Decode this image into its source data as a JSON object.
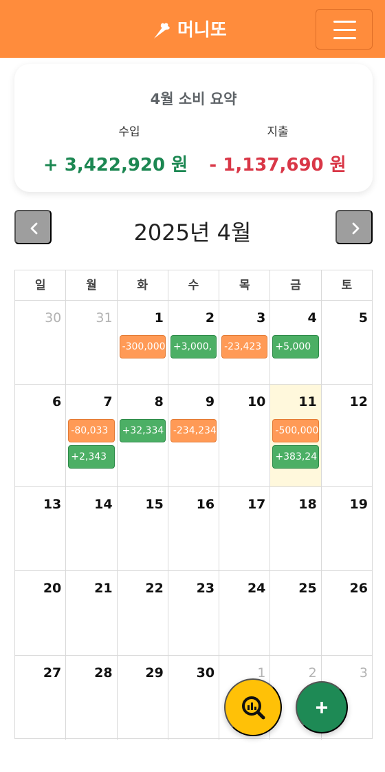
{
  "app": {
    "name": "머니또"
  },
  "summary": {
    "title": "4월 소비 요약",
    "income_label": "수입",
    "expense_label": "지출",
    "income_amount": "+ 3,422,920 원",
    "expense_amount": "- 1,137,690 원"
  },
  "calendar": {
    "month_title": "2025년 4월",
    "weekdays": [
      "일",
      "월",
      "화",
      "수",
      "목",
      "금",
      "토"
    ],
    "weeks": [
      [
        {
          "day": "30",
          "other": true,
          "tx": []
        },
        {
          "day": "31",
          "other": true,
          "tx": []
        },
        {
          "day": "1",
          "tx": [
            {
              "type": "expense",
              "text": "-300,000"
            }
          ]
        },
        {
          "day": "2",
          "tx": [
            {
              "type": "income",
              "text": "+3,000,"
            }
          ]
        },
        {
          "day": "3",
          "tx": [
            {
              "type": "expense",
              "text": "-23,423"
            }
          ]
        },
        {
          "day": "4",
          "tx": [
            {
              "type": "income",
              "text": "+5,000"
            }
          ]
        },
        {
          "day": "5",
          "tx": []
        }
      ],
      [
        {
          "day": "6",
          "tx": []
        },
        {
          "day": "7",
          "tx": [
            {
              "type": "expense",
              "text": "-80,033"
            },
            {
              "type": "income",
              "text": "+2,343"
            }
          ]
        },
        {
          "day": "8",
          "tx": [
            {
              "type": "income",
              "text": "+32,334"
            }
          ]
        },
        {
          "day": "9",
          "tx": [
            {
              "type": "expense",
              "text": "-234,234"
            }
          ]
        },
        {
          "day": "10",
          "tx": []
        },
        {
          "day": "11",
          "today": true,
          "tx": [
            {
              "type": "expense",
              "text": "-500,000"
            },
            {
              "type": "income",
              "text": "+383,24"
            }
          ]
        },
        {
          "day": "12",
          "tx": []
        }
      ],
      [
        {
          "day": "13",
          "tx": []
        },
        {
          "day": "14",
          "tx": []
        },
        {
          "day": "15",
          "tx": []
        },
        {
          "day": "16",
          "tx": []
        },
        {
          "day": "17",
          "tx": []
        },
        {
          "day": "18",
          "tx": []
        },
        {
          "day": "19",
          "tx": []
        }
      ],
      [
        {
          "day": "20",
          "tx": []
        },
        {
          "day": "21",
          "tx": []
        },
        {
          "day": "22",
          "tx": []
        },
        {
          "day": "23",
          "tx": []
        },
        {
          "day": "24",
          "tx": []
        },
        {
          "day": "25",
          "tx": []
        },
        {
          "day": "26",
          "tx": []
        }
      ],
      [
        {
          "day": "27",
          "tx": []
        },
        {
          "day": "28",
          "tx": []
        },
        {
          "day": "29",
          "tx": []
        },
        {
          "day": "30",
          "tx": []
        },
        {
          "day": "1",
          "other": true,
          "tx": []
        },
        {
          "day": "2",
          "other": true,
          "tx": []
        },
        {
          "day": "3",
          "other": true,
          "tx": []
        }
      ]
    ]
  },
  "fab": {
    "add_label": "+"
  },
  "icons": {
    "logo": "carrot-icon",
    "menu": "hamburger-menu-icon",
    "prev": "chevron-left-icon",
    "next": "chevron-right-icon",
    "stats": "search-chart-icon"
  },
  "colors": {
    "brand": "#FF8C3C",
    "income": "#1c8752",
    "expense": "#d93747",
    "income_tag": "#4CAF65",
    "expense_tag": "#FF9A56",
    "today_bg": "#FFF8DC",
    "stats_fab": "#FFC107",
    "add_fab": "#1E8A55"
  }
}
